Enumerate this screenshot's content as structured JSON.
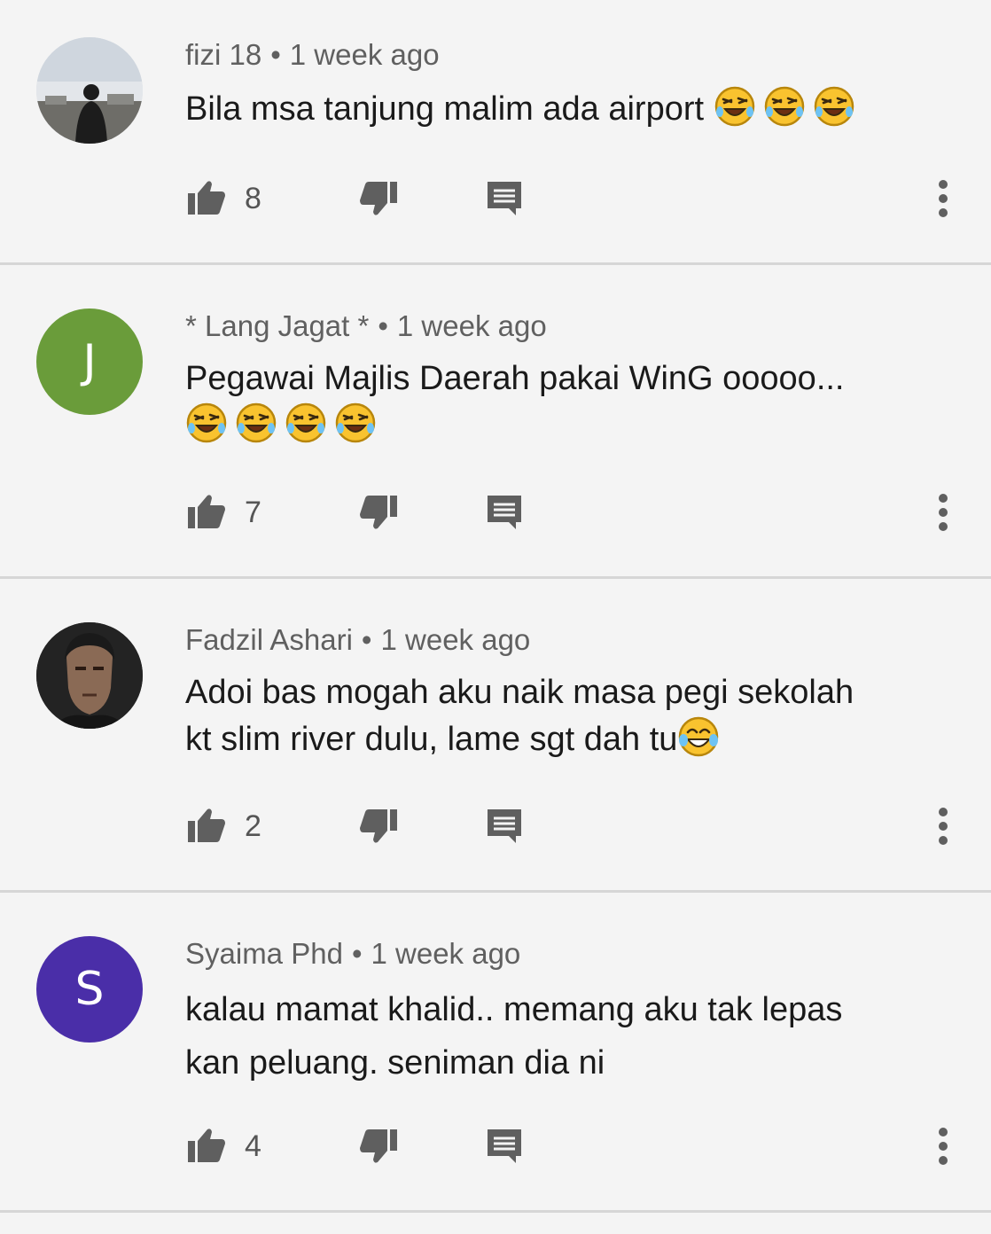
{
  "comments": [
    {
      "author": "fizi 18",
      "time": "1 week ago",
      "line1": "Bila msa tanjung malim ada airport ",
      "emoji1": "rofl x3",
      "likes": "8",
      "avatar_kind": "photo-silhouette"
    },
    {
      "author": "* Lang Jagat *",
      "time": "1 week ago",
      "line1": "Pegawai Majlis Daerah pakai WinG ooooo...",
      "emoji2": "rofl x4",
      "likes": "7",
      "initial": "J",
      "avatar_color": "#6a9c3a"
    },
    {
      "author": "Fadzil Ashari",
      "time": "1 week ago",
      "line1": "Adoi bas mogah aku naik masa pegi sekolah",
      "line2": "kt slim river dulu, lame sgt dah tu",
      "emoji_tail": "joy",
      "likes": "2",
      "avatar_kind": "photo-portrait"
    },
    {
      "author": "Syaima Phd",
      "time": "1 week ago",
      "line1": "kalau mamat khalid.. memang aku tak lepas",
      "line2": "kan peluang. seniman dia ni",
      "likes": "4",
      "initial": "S",
      "avatar_color": "#4a2ea8"
    }
  ],
  "separator": "•",
  "icons": [
    "thumb-up-icon",
    "thumb-down-icon",
    "reply-icon",
    "more-vert-icon"
  ],
  "colors": {
    "background": "#f4f4f4",
    "meta": "#606060",
    "icon": "#5f5f5f",
    "divider": "#d6d6d6"
  }
}
